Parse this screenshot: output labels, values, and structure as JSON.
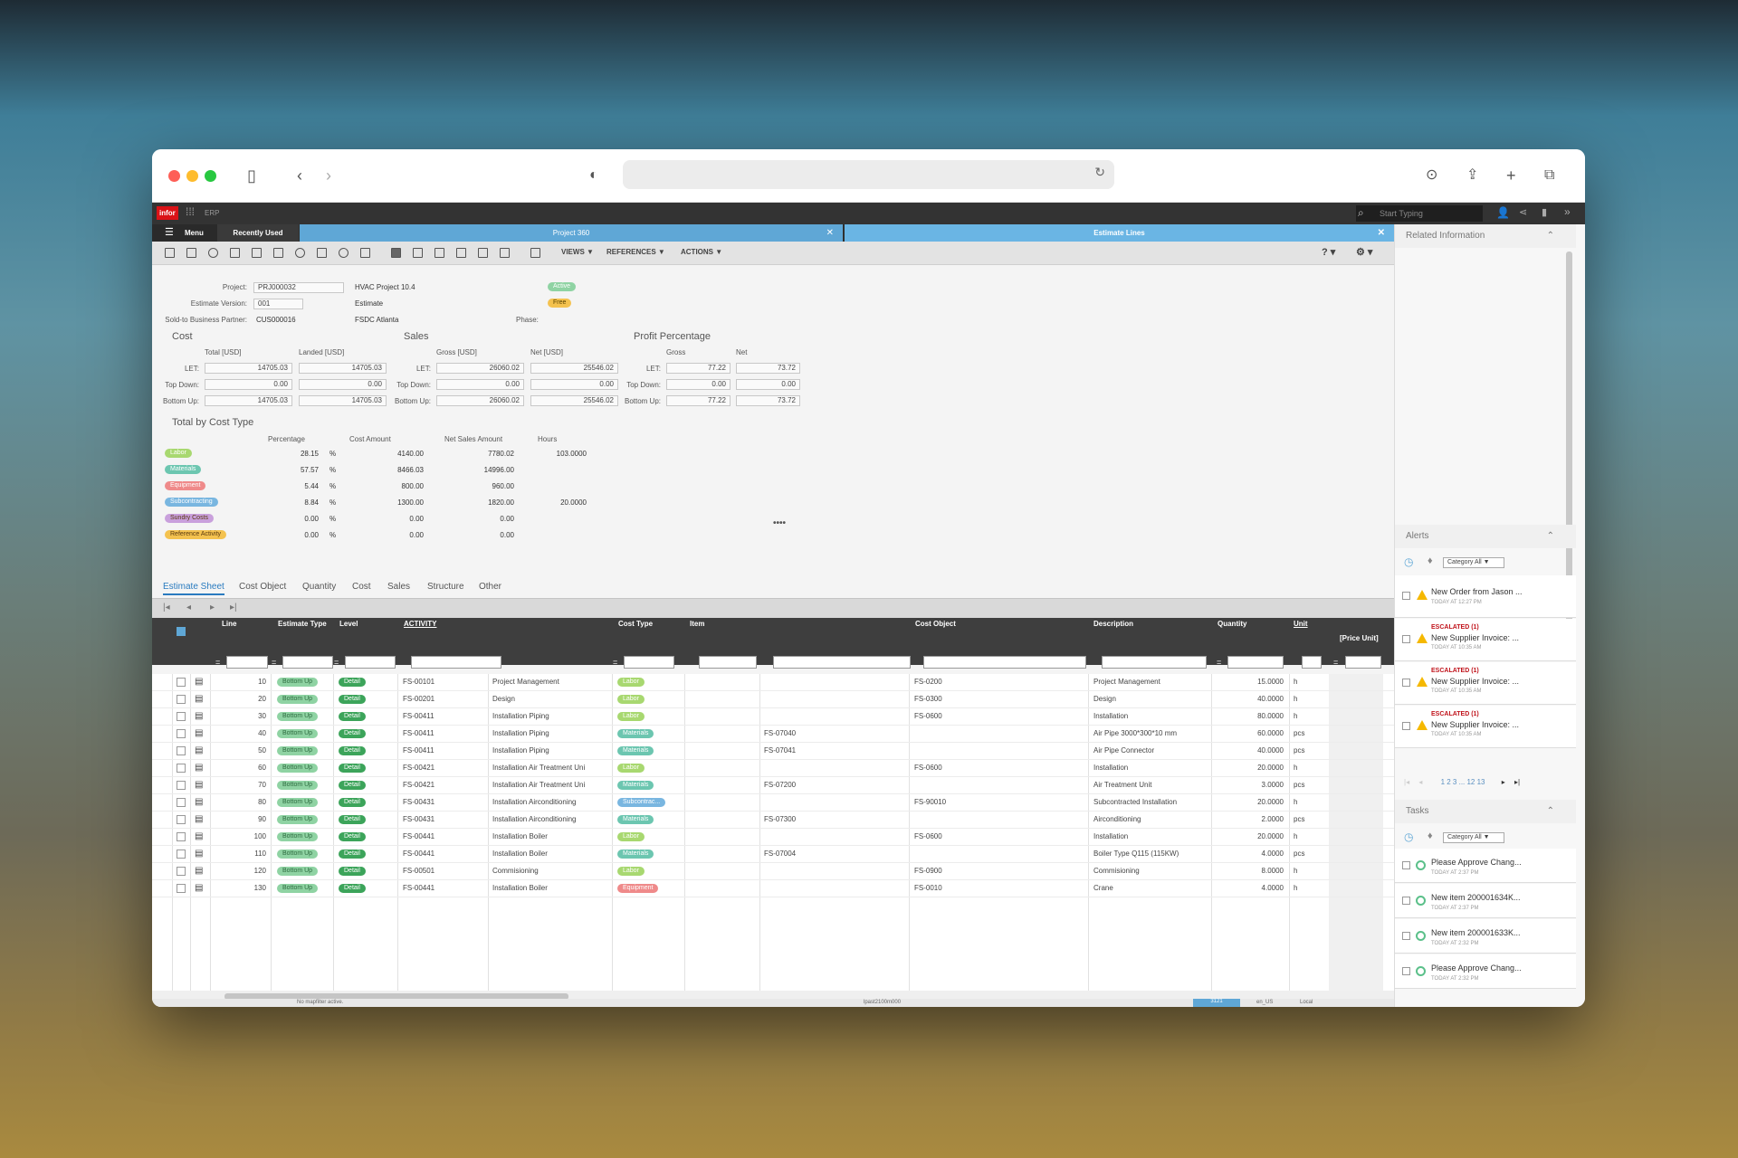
{
  "app": {
    "logo": "infor",
    "product": "ERP",
    "search_placeholder": "Start Typing",
    "menu": "Menu",
    "recent": "Recently Used"
  },
  "tabs": [
    {
      "label": "Project 360"
    },
    {
      "label": "Estimate Lines"
    }
  ],
  "toolbar_menus": [
    "VIEWS ▼",
    "REFERENCES ▼",
    "ACTIONS ▼"
  ],
  "header": {
    "project_label": "Project:",
    "project_value": "PRJ000032",
    "project_name": "HVAC Project 10.4",
    "project_status": "Active",
    "version_label": "Estimate Version:",
    "version_value": "001",
    "version_name": "Estimate",
    "version_status": "Free",
    "partner_label": "Sold-to Business Partner:",
    "partner_value": "CUS000016",
    "partner_name": "FSDC Atlanta",
    "phase_label": "Phase:"
  },
  "cost": {
    "title": "Cost",
    "col1": "Total [USD]",
    "col2": "Landed [USD]",
    "rows": [
      {
        "label": "LET:",
        "v1": "14705.03",
        "v2": "14705.03"
      },
      {
        "label": "Top Down:",
        "v1": "0.00",
        "v2": "0.00"
      },
      {
        "label": "Bottom Up:",
        "v1": "14705.03",
        "v2": "14705.03"
      }
    ]
  },
  "sales": {
    "title": "Sales",
    "col1": "Gross [USD]",
    "col2": "Net [USD]",
    "rows": [
      {
        "label": "LET:",
        "v1": "26060.02",
        "v2": "25546.02"
      },
      {
        "label": "Top Down:",
        "v1": "0.00",
        "v2": "0.00"
      },
      {
        "label": "Bottom Up:",
        "v1": "26060.02",
        "v2": "25546.02"
      }
    ]
  },
  "profit": {
    "title": "Profit Percentage",
    "col1": "Gross",
    "col2": "Net",
    "rows": [
      {
        "label": "LET:",
        "v1": "77.22",
        "v2": "73.72"
      },
      {
        "label": "Top Down:",
        "v1": "0.00",
        "v2": "0.00"
      },
      {
        "label": "Bottom Up:",
        "v1": "77.22",
        "v2": "73.72"
      }
    ]
  },
  "cost_type": {
    "title": "Total by Cost Type",
    "headers": [
      "Percentage",
      "Cost Amount",
      "Net Sales Amount",
      "Hours"
    ],
    "rows": [
      {
        "name": "Labor",
        "pct": "28.15",
        "cost": "4140.00",
        "sales": "7780.02",
        "hours": "103.0000"
      },
      {
        "name": "Materials",
        "pct": "57.57",
        "cost": "8466.03",
        "sales": "14996.00",
        "hours": ""
      },
      {
        "name": "Equipment",
        "pct": "5.44",
        "cost": "800.00",
        "sales": "960.00",
        "hours": ""
      },
      {
        "name": "Subcontracting",
        "pct": "8.84",
        "cost": "1300.00",
        "sales": "1820.00",
        "hours": "20.0000"
      },
      {
        "name": "Sundry Costs",
        "pct": "0.00",
        "cost": "0.00",
        "sales": "0.00",
        "hours": ""
      },
      {
        "name": "Reference Activity",
        "pct": "0.00",
        "cost": "0.00",
        "sales": "0.00",
        "hours": ""
      }
    ],
    "pct_unit": "%"
  },
  "subtabs": [
    "Estimate Sheet",
    "Cost Object",
    "Quantity",
    "Cost",
    "Sales",
    "Structure",
    "Other"
  ],
  "grid": {
    "headers": [
      "Line",
      "Estimate Type",
      "Level",
      "ACTIVITY",
      "Cost Type",
      "Item",
      "Cost Object",
      "Description",
      "Quantity",
      "Unit",
      "[Price Unit]"
    ],
    "rows": [
      {
        "line": "10",
        "type": "Bottom Up",
        "level": "Detail",
        "act": "FS-00101",
        "actdesc": "Project Management",
        "ctype": "Labor",
        "item": "",
        "cobj": "FS-0200",
        "desc": "Project Management",
        "qty": "15.0000",
        "unit": "h"
      },
      {
        "line": "20",
        "type": "Bottom Up",
        "level": "Detail",
        "act": "FS-00201",
        "actdesc": "Design",
        "ctype": "Labor",
        "item": "",
        "cobj": "FS-0300",
        "desc": "Design",
        "qty": "40.0000",
        "unit": "h"
      },
      {
        "line": "30",
        "type": "Bottom Up",
        "level": "Detail",
        "act": "FS-00411",
        "actdesc": "Installation Piping",
        "ctype": "Labor",
        "item": "",
        "cobj": "FS-0600",
        "desc": "Installation",
        "qty": "80.0000",
        "unit": "h"
      },
      {
        "line": "40",
        "type": "Bottom Up",
        "level": "Detail",
        "act": "FS-00411",
        "actdesc": "Installation Piping",
        "ctype": "Materials",
        "item": "FS-07040",
        "cobj": "",
        "desc": "Air Pipe 3000*300*10 mm",
        "qty": "60.0000",
        "unit": "pcs"
      },
      {
        "line": "50",
        "type": "Bottom Up",
        "level": "Detail",
        "act": "FS-00411",
        "actdesc": "Installation Piping",
        "ctype": "Materials",
        "item": "FS-07041",
        "cobj": "",
        "desc": "Air Pipe Connector",
        "qty": "40.0000",
        "unit": "pcs"
      },
      {
        "line": "60",
        "type": "Bottom Up",
        "level": "Detail",
        "act": "FS-00421",
        "actdesc": "Installation Air Treatment Uni",
        "ctype": "Labor",
        "item": "",
        "cobj": "FS-0600",
        "desc": "Installation",
        "qty": "20.0000",
        "unit": "h"
      },
      {
        "line": "70",
        "type": "Bottom Up",
        "level": "Detail",
        "act": "FS-00421",
        "actdesc": "Installation Air Treatment Uni",
        "ctype": "Materials",
        "item": "FS-07200",
        "cobj": "",
        "desc": "Air Treatment Unit",
        "qty": "3.0000",
        "unit": "pcs"
      },
      {
        "line": "80",
        "type": "Bottom Up",
        "level": "Detail",
        "act": "FS-00431",
        "actdesc": "Installation Airconditioning",
        "ctype": "Subcontrac...",
        "item": "",
        "cobj": "FS-90010",
        "desc": "Subcontracted Installation",
        "qty": "20.0000",
        "unit": "h"
      },
      {
        "line": "90",
        "type": "Bottom Up",
        "level": "Detail",
        "act": "FS-00431",
        "actdesc": "Installation Airconditioning",
        "ctype": "Materials",
        "item": "FS-07300",
        "cobj": "",
        "desc": "Airconditioning",
        "qty": "2.0000",
        "unit": "pcs"
      },
      {
        "line": "100",
        "type": "Bottom Up",
        "level": "Detail",
        "act": "FS-00441",
        "actdesc": "Installation Boiler",
        "ctype": "Labor",
        "item": "",
        "cobj": "FS-0600",
        "desc": "Installation",
        "qty": "20.0000",
        "unit": "h"
      },
      {
        "line": "110",
        "type": "Bottom Up",
        "level": "Detail",
        "act": "FS-00441",
        "actdesc": "Installation Boiler",
        "ctype": "Materials",
        "item": "FS-07004",
        "cobj": "",
        "desc": "Boiler Type Q115 (115KW)",
        "qty": "4.0000",
        "unit": "pcs"
      },
      {
        "line": "120",
        "type": "Bottom Up",
        "level": "Detail",
        "act": "FS-00501",
        "actdesc": "Commisioning",
        "ctype": "Labor",
        "item": "",
        "cobj": "FS-0900",
        "desc": "Commisioning",
        "qty": "8.0000",
        "unit": "h"
      },
      {
        "line": "130",
        "type": "Bottom Up",
        "level": "Detail",
        "act": "FS-00441",
        "actdesc": "Installation Boiler",
        "ctype": "Equipment",
        "item": "",
        "cobj": "FS-0010",
        "desc": "Crane",
        "qty": "4.0000",
        "unit": "h"
      }
    ]
  },
  "statusbar": {
    "left": "No mapfilter active.",
    "mid": "lpast2100m000",
    "code": "3121",
    "locale": "en_US",
    "mode": "Local"
  },
  "sidebar": {
    "related": "Related Information",
    "alerts_title": "Alerts",
    "tasks_title": "Tasks",
    "category": "Category All ▼",
    "alerts": [
      {
        "esc": "",
        "title": "New Order from Jason ...",
        "time": "TODAY AT 12:27 PM"
      },
      {
        "esc": "ESCALATED (1)",
        "title": "New Supplier Invoice: ...",
        "time": "TODAY AT 10:35 AM"
      },
      {
        "esc": "ESCALATED (1)",
        "title": "New Supplier Invoice: ...",
        "time": "TODAY AT 10:35 AM"
      },
      {
        "esc": "ESCALATED (1)",
        "title": "New Supplier Invoice: ...",
        "time": "TODAY AT 10:35 AM"
      }
    ],
    "pager": "1  2  3  ...  12  13",
    "tasks": [
      {
        "title": "Please Approve Chang...",
        "time": "TODAY AT 2:37 PM"
      },
      {
        "title": "New item 200001634K...",
        "time": "TODAY AT 2:37 PM"
      },
      {
        "title": "New item 200001633K...",
        "time": "TODAY AT 2:32 PM"
      },
      {
        "title": "Please Approve Chang...",
        "time": "TODAY AT 2:32 PM"
      }
    ]
  },
  "colors": {
    "labor": "#a8d870",
    "materials": "#6cc6b0",
    "equipment": "#ef8a8a",
    "subcontracting": "#79b6e0",
    "sundry": "#c9a0dc",
    "reference": "#f4c24f",
    "est": "#8fd3a3",
    "detail": "#3ca45a"
  }
}
